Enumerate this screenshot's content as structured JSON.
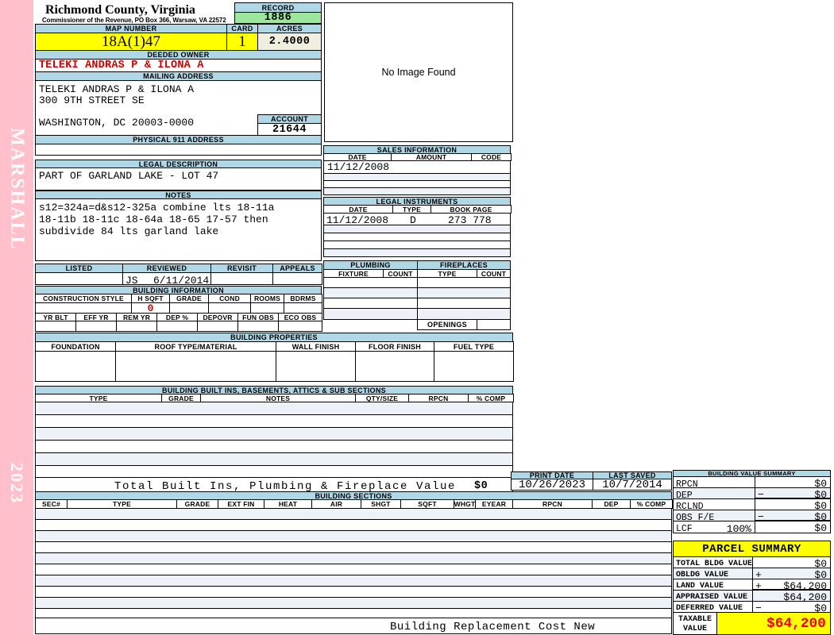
{
  "header": {
    "title": "Richmond County, Virginia",
    "subtitle": "Commissioner of the Revenue, PO Box 366, Warsaw, VA 22572"
  },
  "sidebar": {
    "vendor": "MARSHALL",
    "year": "2023"
  },
  "record": {
    "label": "RECORD",
    "value": "1886"
  },
  "map_number": {
    "label": "MAP NUMBER",
    "value": "18A(1)47"
  },
  "card": {
    "label": "CARD",
    "value": "1"
  },
  "acres": {
    "label": "ACRES",
    "value": "2.4000"
  },
  "deeded_owner": {
    "label": "DEEDED OWNER",
    "value": "TELEKI ANDRAS P & ILONA A"
  },
  "mailing": {
    "label": "MAILING ADDRESS",
    "lines": [
      "TELEKI ANDRAS P & ILONA A",
      "300 9TH STREET SE",
      "WASHINGTON, DC 20003-0000"
    ]
  },
  "account": {
    "label": "ACCOUNT",
    "value": "21644"
  },
  "physical911": {
    "label": "PHYSICAL 911 ADDRESS",
    "value": ""
  },
  "legal_description": {
    "label": "LEGAL DESCRIPTION",
    "value": "PART OF GARLAND LAKE - LOT 47"
  },
  "notes": {
    "label": "NOTES",
    "lines": [
      "s12=324a=d&s12-325a combine lts 18-11a",
      "18-11b 18-11c 18-64a 18-65 17-57 then",
      "subdivide 84 lts garland lake"
    ]
  },
  "review": {
    "headers": [
      "LISTED",
      "REVIEWED",
      "REVISIT",
      "APPEALS"
    ],
    "by": "JS",
    "date": "6/11/2014"
  },
  "building_info": {
    "label": "BUILDING INFORMATION",
    "headers1": [
      "CONSTRUCTION STYLE",
      "H SQFT",
      "GRADE",
      "COND",
      "ROOMS",
      "BDRMS"
    ],
    "hsqft": "0",
    "headers2": [
      "YR BLT",
      "EFF YR",
      "REM YR",
      "DEP %",
      "DEPOVR",
      "FUN OBS",
      "ECO OBS"
    ]
  },
  "building_properties": {
    "label": "BUILDING PROPERTIES",
    "headers": [
      "FOUNDATION",
      "ROOF TYPE/MATERIAL",
      "WALL FINISH",
      "FLOOR FINISH",
      "FUEL TYPE"
    ]
  },
  "built_ins": {
    "label": "BUILDING BUILT INS, BASEMENTS, ATTICS & SUB SECTIONS",
    "headers": [
      "TYPE",
      "GRADE",
      "NOTES",
      "QTY/SIZE",
      "RPCN",
      "% COMP"
    ],
    "total_label": "Total Built Ins, Plumbing & Fireplace Value",
    "total_value": "$0"
  },
  "no_image": {
    "text": "No Image Found"
  },
  "sales": {
    "label": "SALES INFORMATION",
    "headers": [
      "DATE",
      "AMOUNT",
      "CODE"
    ],
    "row": {
      "date": "11/12/2008",
      "amount": "",
      "code": ""
    }
  },
  "legal_instruments": {
    "label": "LEGAL INSTRUMENTS",
    "headers": [
      "DATE",
      "TYPE",
      "BOOK PAGE"
    ],
    "row": {
      "date": "11/12/2008",
      "type": "D",
      "book_page": "273 778"
    }
  },
  "plumbing": {
    "label": "PLUMBING",
    "headers": [
      "FIXTURE",
      "COUNT"
    ]
  },
  "fireplaces": {
    "label": "FIREPLACES",
    "headers": [
      "TYPE",
      "COUNT"
    ],
    "openings_label": "OPENINGS"
  },
  "print_info": {
    "print_date_label": "PRINT DATE",
    "print_date": "10/26/2023",
    "last_saved_label": "LAST SAVED",
    "last_saved": "10/7/2014"
  },
  "building_sections": {
    "label": "BUILDING SECTIONS",
    "headers": [
      "SEC#",
      "TYPE",
      "GRADE",
      "EXT FIN",
      "HEAT",
      "AIR",
      "SHGT",
      "SQFT",
      "WHGT",
      "EYEAR",
      "RPCN",
      "DEP",
      "% COMP"
    ],
    "footer": "Building Replacement Cost New"
  },
  "building_value_summary": {
    "label": "BUILDING VALUE SUMMARY",
    "rows": [
      {
        "label": "RPCN",
        "op": "",
        "value": "$0"
      },
      {
        "label": "DEP",
        "op": "−",
        "value": "$0"
      },
      {
        "label": "RCLND",
        "op": "",
        "value": "$0"
      },
      {
        "label": "OBS F/E",
        "op": "−",
        "value": "$0"
      },
      {
        "label": "LCF",
        "pct": "100%",
        "op": "",
        "value": "$0"
      }
    ]
  },
  "parcel_summary": {
    "label": "PARCEL SUMMARY",
    "rows": [
      {
        "label": "TOTAL BLDG VALUE",
        "op": "",
        "value": "$0"
      },
      {
        "label": "OBLDG VALUE",
        "op": "+",
        "value": "$0"
      },
      {
        "label": "LAND VALUE",
        "op": "+",
        "value": "$64,200"
      },
      {
        "label": "APPRAISED VALUE",
        "op": "",
        "value": "$64,200"
      },
      {
        "label": "DEFERRED VALUE",
        "op": "−",
        "value": "$0"
      }
    ],
    "taxable": {
      "label1": "TAXABLE",
      "label2": "VALUE",
      "value": "$64,200"
    }
  },
  "colors": {
    "sidebar_pink": "#FFC0CB",
    "bar_blue": "#AFD7E6",
    "highlight_yellow": "#FFFF00",
    "record_green": "#9DE69D",
    "acres_cream": "#F0EFDF",
    "owner_red": "#CC0000",
    "taxable_red": "#EE0000",
    "stripe_blue": "#EDF2F9"
  }
}
